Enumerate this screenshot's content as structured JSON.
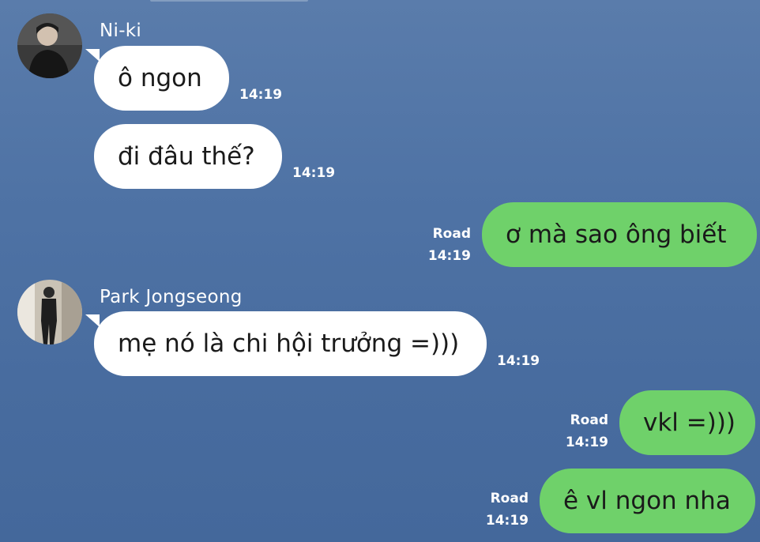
{
  "chat": {
    "messages": [
      {
        "sender": "Ni-ki",
        "text": "ô ngon",
        "time": "14:19"
      },
      {
        "text": "đi đâu thế?",
        "time": "14:19"
      },
      {
        "text": "ơ mà sao ông biết",
        "status": "Road",
        "time": "14:19"
      },
      {
        "sender": "Park Jongseong",
        "text": "mẹ nó là chi hội trưởng =)))",
        "time": "14:19"
      },
      {
        "text": "vkl =)))",
        "status": "Road",
        "time": "14:19"
      },
      {
        "text": "ê vl ngon nha",
        "status": "Road",
        "time": "14:19"
      }
    ]
  },
  "colors": {
    "background": "#4f73a5",
    "incoming_bubble": "#ffffff",
    "outgoing_bubble": "#6fd16a",
    "text": "#1a1a1a"
  },
  "icons": {
    "avatar_1": "avatar-photo",
    "avatar_2": "avatar-photo"
  }
}
